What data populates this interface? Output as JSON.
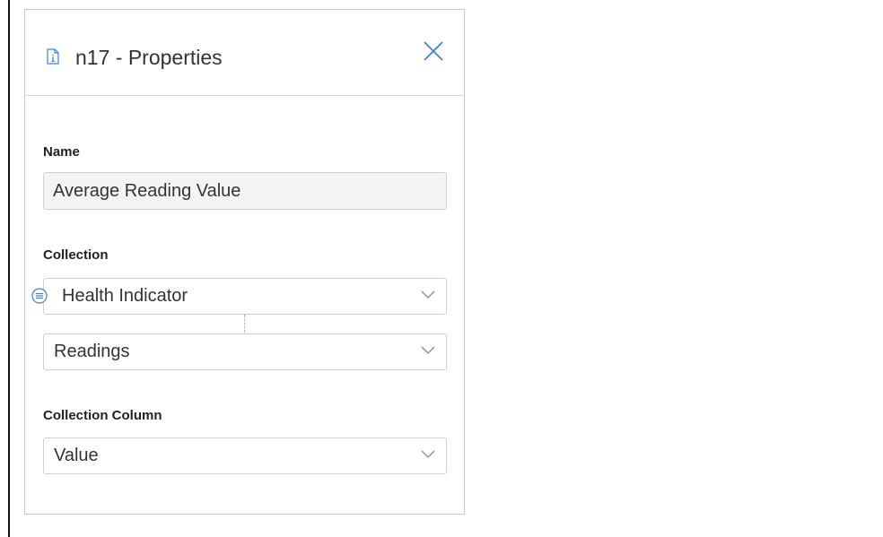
{
  "panel": {
    "title": "n17 - Properties",
    "header_icon": "document-info-icon",
    "close_icon": "close-icon"
  },
  "fields": {
    "name": {
      "label": "Name",
      "value": "Average Reading Value"
    },
    "collection": {
      "label": "Collection",
      "primary": {
        "value": "Health Indicator",
        "icon": "list-icon"
      },
      "secondary": {
        "value": "Readings"
      }
    },
    "collection_column": {
      "label": "Collection Column",
      "value": "Value"
    }
  },
  "colors": {
    "accent": "#3f82d4",
    "border": "#cfcfcf",
    "input_bg": "#f4f4f4"
  }
}
